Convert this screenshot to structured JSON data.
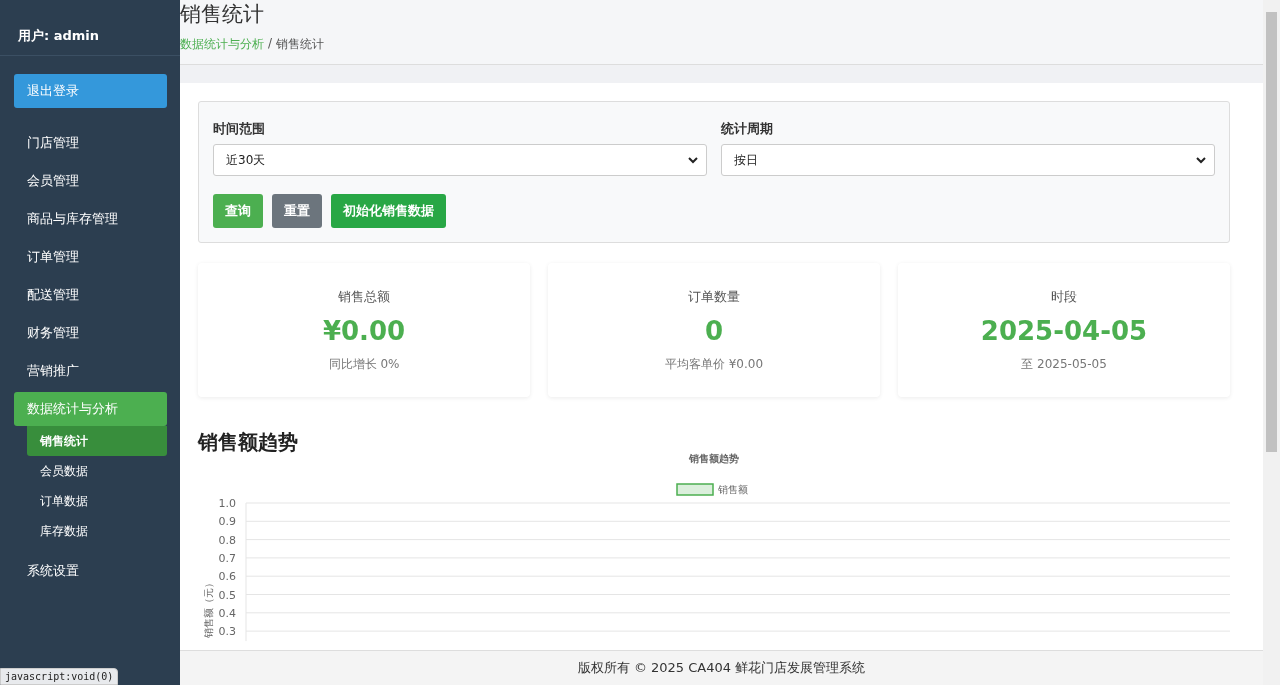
{
  "sidebar": {
    "user": "用户: admin",
    "logout": "退出登录",
    "items": [
      {
        "label": "门店管理",
        "selected": false
      },
      {
        "label": "会员管理",
        "selected": false
      },
      {
        "label": "商品与库存管理",
        "selected": false
      },
      {
        "label": "订单管理",
        "selected": false
      },
      {
        "label": "配送管理",
        "selected": false
      },
      {
        "label": "财务管理",
        "selected": false
      },
      {
        "label": "营销推广",
        "selected": false
      },
      {
        "label": "数据统计与分析",
        "selected": true,
        "children": [
          {
            "label": "销售统计",
            "selected": true
          },
          {
            "label": "会员数据",
            "selected": false
          },
          {
            "label": "订单数据",
            "selected": false
          },
          {
            "label": "库存数据",
            "selected": false
          }
        ]
      },
      {
        "label": "系统设置",
        "selected": false
      }
    ]
  },
  "header": {
    "title": "销售统计",
    "breadcrumb": [
      {
        "label": "数据统计与分析",
        "kind": "link"
      },
      {
        "label": "销售统计",
        "kind": "current"
      }
    ],
    "separator": "/"
  },
  "filters": [
    {
      "label": "时间范围",
      "value": "近30天"
    },
    {
      "label": "统计周期",
      "value": "按日"
    }
  ],
  "buttons": [
    {
      "label": "查询",
      "kind": "primary"
    },
    {
      "label": "重置",
      "kind": "secondary"
    },
    {
      "label": "初始化销售数据",
      "kind": "success"
    }
  ],
  "stats": [
    {
      "title": "销售总额",
      "value": "¥0.00",
      "note": "同比增长 0%"
    },
    {
      "title": "订单数量",
      "value": "0",
      "note": "平均客单价 ¥0.00"
    },
    {
      "title": "时段",
      "value": "2025-04-05",
      "note": "至 2025-05-05"
    }
  ],
  "trend": {
    "heading": "销售额趋势",
    "chart_data": {
      "type": "line",
      "title": "销售额趋势",
      "ylabel": "销售额（元）",
      "ylim": [
        0.3,
        1
      ],
      "grid": true,
      "yticks": [
        {
          "value": 1,
          "label": "1.0"
        },
        0.9,
        0.8,
        0.7,
        0.6,
        0.5,
        0.4,
        0.3
      ],
      "series": [
        {
          "name": "销售额",
          "color": "#4caf50"
        }
      ]
    }
  },
  "footer": "版权所有 © 2025 CA404 鲜花门店发展管理系统",
  "status_url": "javascript:void(0)"
}
